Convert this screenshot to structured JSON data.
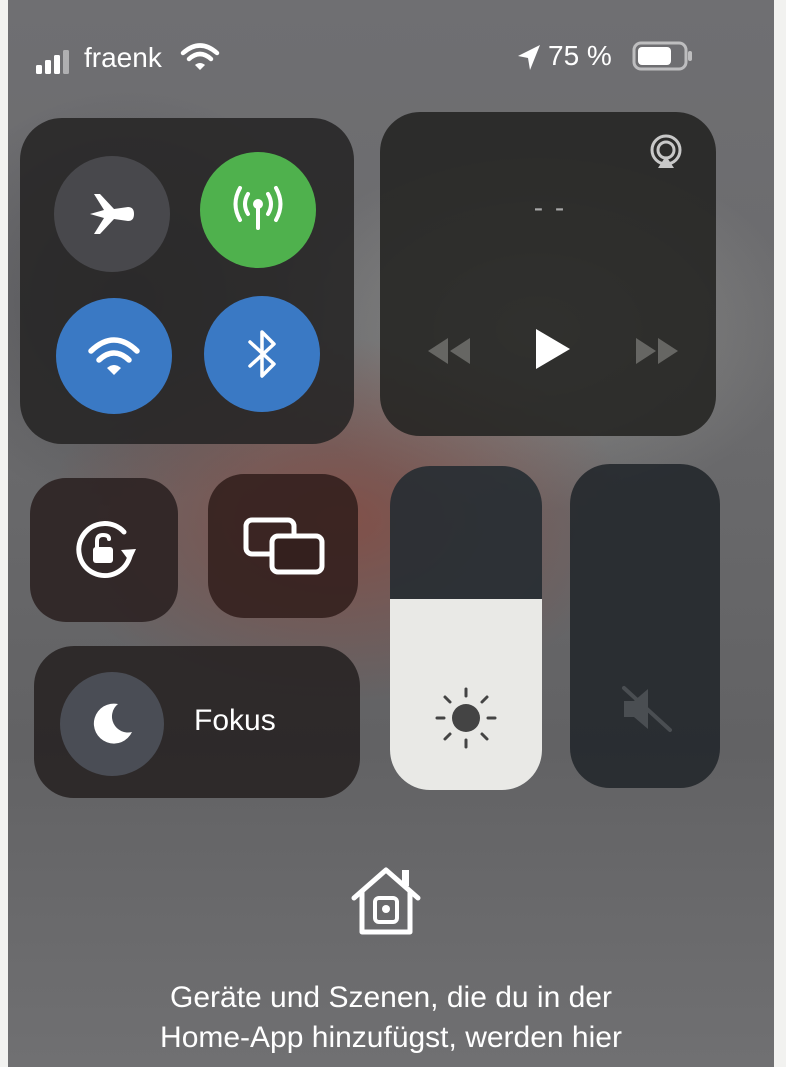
{
  "status_bar": {
    "carrier": "fraenk",
    "battery_percent": "75 %",
    "battery_level": 0.75,
    "icons": [
      "signal-bars-icon",
      "wifi-icon",
      "location-arrow-icon",
      "battery-icon"
    ]
  },
  "connectivity": {
    "airplane_mode": {
      "icon": "airplane-icon",
      "state": "off"
    },
    "cellular_data": {
      "icon": "antenna-icon",
      "state": "on"
    },
    "wifi": {
      "icon": "wifi-icon",
      "state": "on"
    },
    "bluetooth": {
      "icon": "bluetooth-icon",
      "state": "on"
    }
  },
  "now_playing": {
    "title": "- -",
    "icons": [
      "airplay-icon",
      "rewind-icon",
      "play-icon",
      "fast-forward-icon"
    ]
  },
  "controls": {
    "orientation_lock": {
      "icon": "orientation-lock-icon"
    },
    "screen_mirroring": {
      "icon": "screen-mirroring-icon"
    },
    "focus": {
      "label": "Fokus",
      "icon": "moon-icon"
    },
    "brightness": {
      "icon": "sun-icon",
      "level": 0.59
    },
    "volume": {
      "icon": "speaker-muted-icon",
      "level": 0
    }
  },
  "home": {
    "icon": "home-icon",
    "message_line1": "Geräte und Szenen, die du in der",
    "message_line2": "Home-App hinzufügst, werden hier"
  },
  "colors": {
    "active_green": "#4fb14d",
    "active_blue": "#3a79c4",
    "inactive_gray": "#48484c"
  }
}
